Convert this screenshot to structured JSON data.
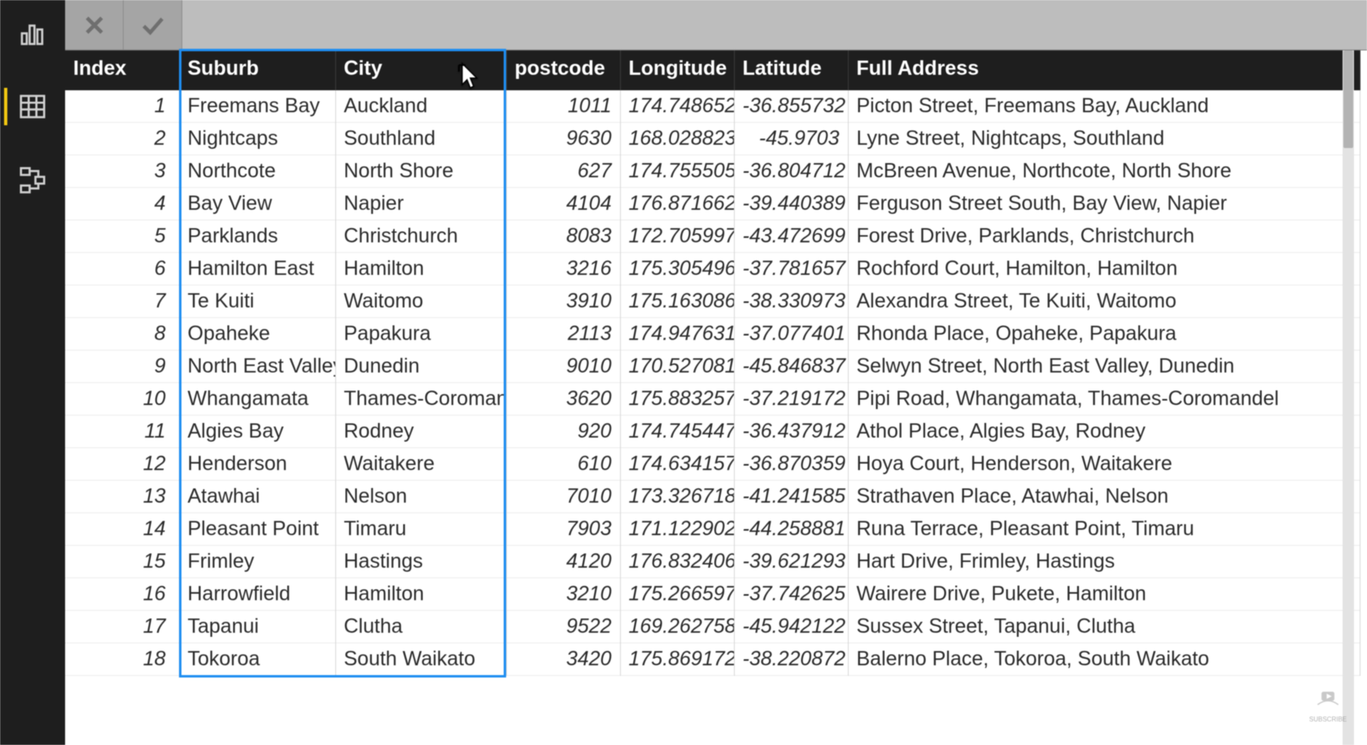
{
  "sidebar": {
    "items": [
      {
        "name": "report-view-icon"
      },
      {
        "name": "data-view-icon"
      },
      {
        "name": "model-view-icon"
      }
    ],
    "active_index": 1
  },
  "formula_bar": {
    "cancel_tooltip": "Cancel",
    "commit_tooltip": "Enter",
    "value": ""
  },
  "columns": [
    {
      "key": "index",
      "label": "Index",
      "type": "int"
    },
    {
      "key": "suburb",
      "label": "Suburb",
      "type": "text"
    },
    {
      "key": "city",
      "label": "City",
      "type": "text"
    },
    {
      "key": "postcode",
      "label": "postcode",
      "type": "int"
    },
    {
      "key": "lon",
      "label": "Longitude",
      "type": "float"
    },
    {
      "key": "lat",
      "label": "Latitude",
      "type": "float"
    },
    {
      "key": "address",
      "label": "Full Address",
      "type": "text"
    }
  ],
  "selected_columns": [
    "suburb",
    "city"
  ],
  "rows": [
    {
      "index": 1,
      "suburb": "Freemans Bay",
      "city": "Auckland",
      "postcode": 1011,
      "lon": 174.748652,
      "lat": -36.855732,
      "address": "Picton Street, Freemans Bay, Auckland"
    },
    {
      "index": 2,
      "suburb": "Nightcaps",
      "city": "Southland",
      "postcode": 9630,
      "lon": 168.028823,
      "lat": -45.9703,
      "address": "Lyne Street, Nightcaps, Southland"
    },
    {
      "index": 3,
      "suburb": "Northcote",
      "city": "North Shore",
      "postcode": 627,
      "lon": 174.755505,
      "lat": -36.804712,
      "address": "McBreen Avenue, Northcote, North Shore"
    },
    {
      "index": 4,
      "suburb": "Bay View",
      "city": "Napier",
      "postcode": 4104,
      "lon": 176.871662,
      "lat": -39.440389,
      "address": "Ferguson Street South, Bay View, Napier"
    },
    {
      "index": 5,
      "suburb": "Parklands",
      "city": "Christchurch",
      "postcode": 8083,
      "lon": 172.705997,
      "lat": -43.472699,
      "address": "Forest Drive, Parklands, Christchurch"
    },
    {
      "index": 6,
      "suburb": "Hamilton East",
      "city": "Hamilton",
      "postcode": 3216,
      "lon": 175.305496,
      "lat": -37.781657,
      "address": "Rochford Court, Hamilton, Hamilton"
    },
    {
      "index": 7,
      "suburb": "Te Kuiti",
      "city": "Waitomo",
      "postcode": 3910,
      "lon": 175.163086,
      "lat": -38.330973,
      "address": "Alexandra Street, Te Kuiti, Waitomo"
    },
    {
      "index": 8,
      "suburb": "Opaheke",
      "city": "Papakura",
      "postcode": 2113,
      "lon": 174.947631,
      "lat": -37.077401,
      "address": "Rhonda Place, Opaheke, Papakura"
    },
    {
      "index": 9,
      "suburb": "North East Valley",
      "city": "Dunedin",
      "postcode": 9010,
      "lon": 170.527081,
      "lat": -45.846837,
      "address": "Selwyn Street, North East Valley, Dunedin"
    },
    {
      "index": 10,
      "suburb": "Whangamata",
      "city": "Thames-Coromandel",
      "postcode": 3620,
      "lon": 175.883257,
      "lat": -37.219172,
      "address": "Pipi Road, Whangamata, Thames-Coromandel"
    },
    {
      "index": 11,
      "suburb": "Algies Bay",
      "city": "Rodney",
      "postcode": 920,
      "lon": 174.745447,
      "lat": -36.437912,
      "address": "Athol Place, Algies Bay, Rodney"
    },
    {
      "index": 12,
      "suburb": "Henderson",
      "city": "Waitakere",
      "postcode": 610,
      "lon": 174.634157,
      "lat": -36.870359,
      "address": "Hoya Court, Henderson, Waitakere"
    },
    {
      "index": 13,
      "suburb": "Atawhai",
      "city": "Nelson",
      "postcode": 7010,
      "lon": 173.326718,
      "lat": -41.241585,
      "address": "Strathaven Place, Atawhai, Nelson"
    },
    {
      "index": 14,
      "suburb": "Pleasant Point",
      "city": "Timaru",
      "postcode": 7903,
      "lon": 171.122902,
      "lat": -44.258881,
      "address": "Runa Terrace, Pleasant Point, Timaru"
    },
    {
      "index": 15,
      "suburb": "Frimley",
      "city": "Hastings",
      "postcode": 4120,
      "lon": 176.832406,
      "lat": -39.621293,
      "address": "Hart Drive, Frimley, Hastings"
    },
    {
      "index": 16,
      "suburb": "Harrowfield",
      "city": "Hamilton",
      "postcode": 3210,
      "lon": 175.266597,
      "lat": -37.742625,
      "address": "Wairere Drive, Pukete, Hamilton"
    },
    {
      "index": 17,
      "suburb": "Tapanui",
      "city": "Clutha",
      "postcode": 9522,
      "lon": 169.262758,
      "lat": -45.942122,
      "address": "Sussex Street, Tapanui, Clutha"
    },
    {
      "index": 18,
      "suburb": "Tokoroa",
      "city": "South Waikato",
      "postcode": 3420,
      "lon": 175.869172,
      "lat": -38.220872,
      "address": "Balerno Place, Tokoroa, South Waikato"
    }
  ],
  "watermark": {
    "label": "SUBSCRIBE"
  }
}
